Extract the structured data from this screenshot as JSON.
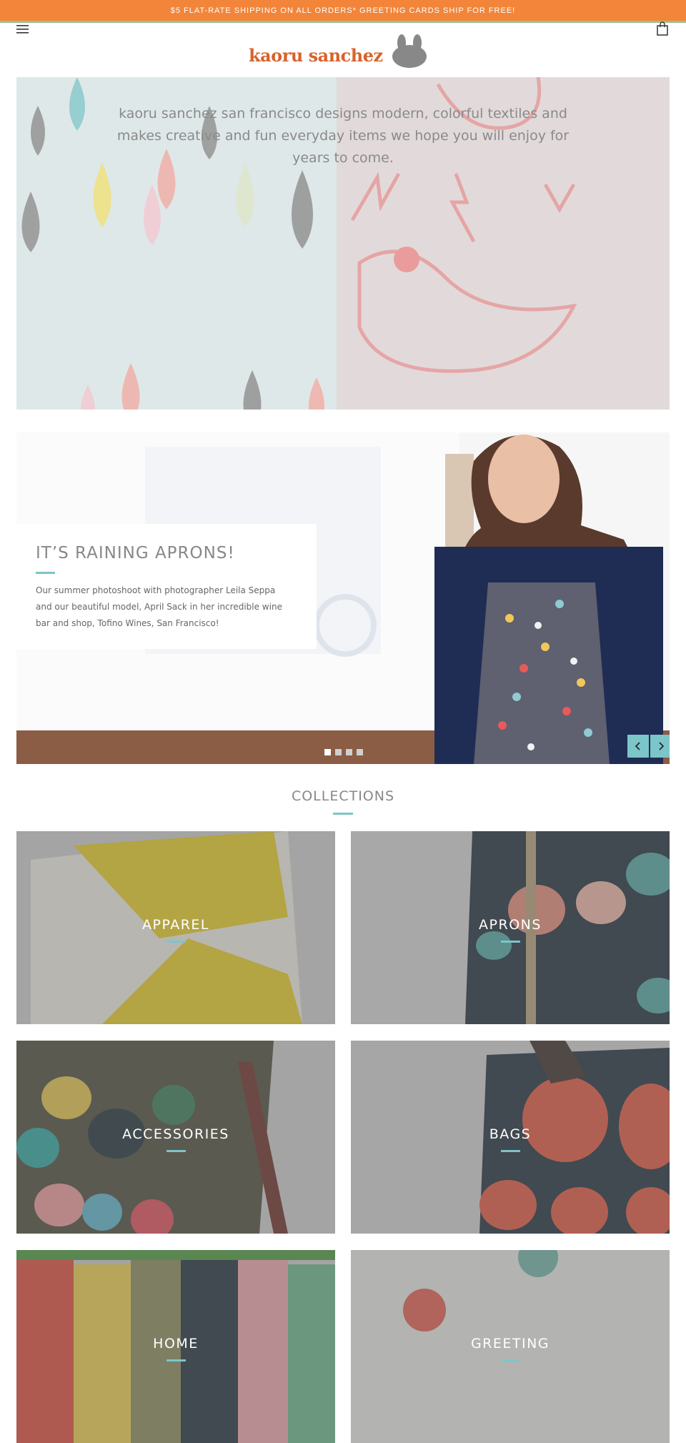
{
  "announcement": "$5 FLAT-RATE SHIPPING ON ALL ORDERS* GREETING CARDS SHIP FOR FREE!",
  "header": {
    "menu_icon": "hamburger-icon",
    "cart_icon": "shopping-bag-icon",
    "logo_text": "kaoru sanchez"
  },
  "hero": {
    "text": "kaoru sanchez san francisco designs modern, colorful textiles and makes creative and fun everyday items we hope you will enjoy for years to come."
  },
  "slideshow": {
    "title": "IT’S RAINING APRONS!",
    "body": "Our summer photoshoot with photographer Leila Seppa and our beautiful model, April Sack in her incredible wine bar and shop, Tofino Wines, San Francisco!",
    "dots": 4,
    "active_dot": 1,
    "prev_icon": "chevron-left-icon",
    "next_icon": "chevron-right-icon"
  },
  "collections": {
    "title": "COLLECTIONS",
    "items": [
      {
        "label": "APPAREL"
      },
      {
        "label": "APRONS"
      },
      {
        "label": "ACCESSORIES"
      },
      {
        "label": "BAGS"
      },
      {
        "label": "HOME"
      },
      {
        "label": "GREETING"
      }
    ]
  },
  "colors": {
    "announcement_bg": "#f2853a",
    "logo": "#d8622a",
    "accent": "#7cc5c9"
  }
}
